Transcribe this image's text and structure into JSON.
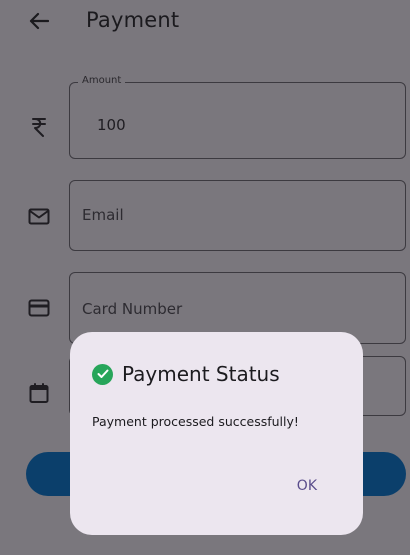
{
  "app_bar": {
    "title": "Payment",
    "back_icon": "arrow-left-icon"
  },
  "form": {
    "amount": {
      "label": "Amount",
      "value": "100",
      "icon": "rupee-icon"
    },
    "email": {
      "placeholder": "Email",
      "icon": "envelope-icon"
    },
    "card_number": {
      "placeholder": "Card Number",
      "icon": "card-icon"
    },
    "expiry": {
      "icon": "calendar-icon"
    }
  },
  "dialog": {
    "title": "Payment Status",
    "message": "Payment processed successfully!",
    "ok_label": "OK",
    "status_icon": "check-circle-icon"
  },
  "colors": {
    "scrim_background": "#7a777d",
    "dialog_background": "#ece6ef",
    "primary_button": "#0b3f6b",
    "success": "#27a55a",
    "dialog_action": "#5a4d8c"
  }
}
